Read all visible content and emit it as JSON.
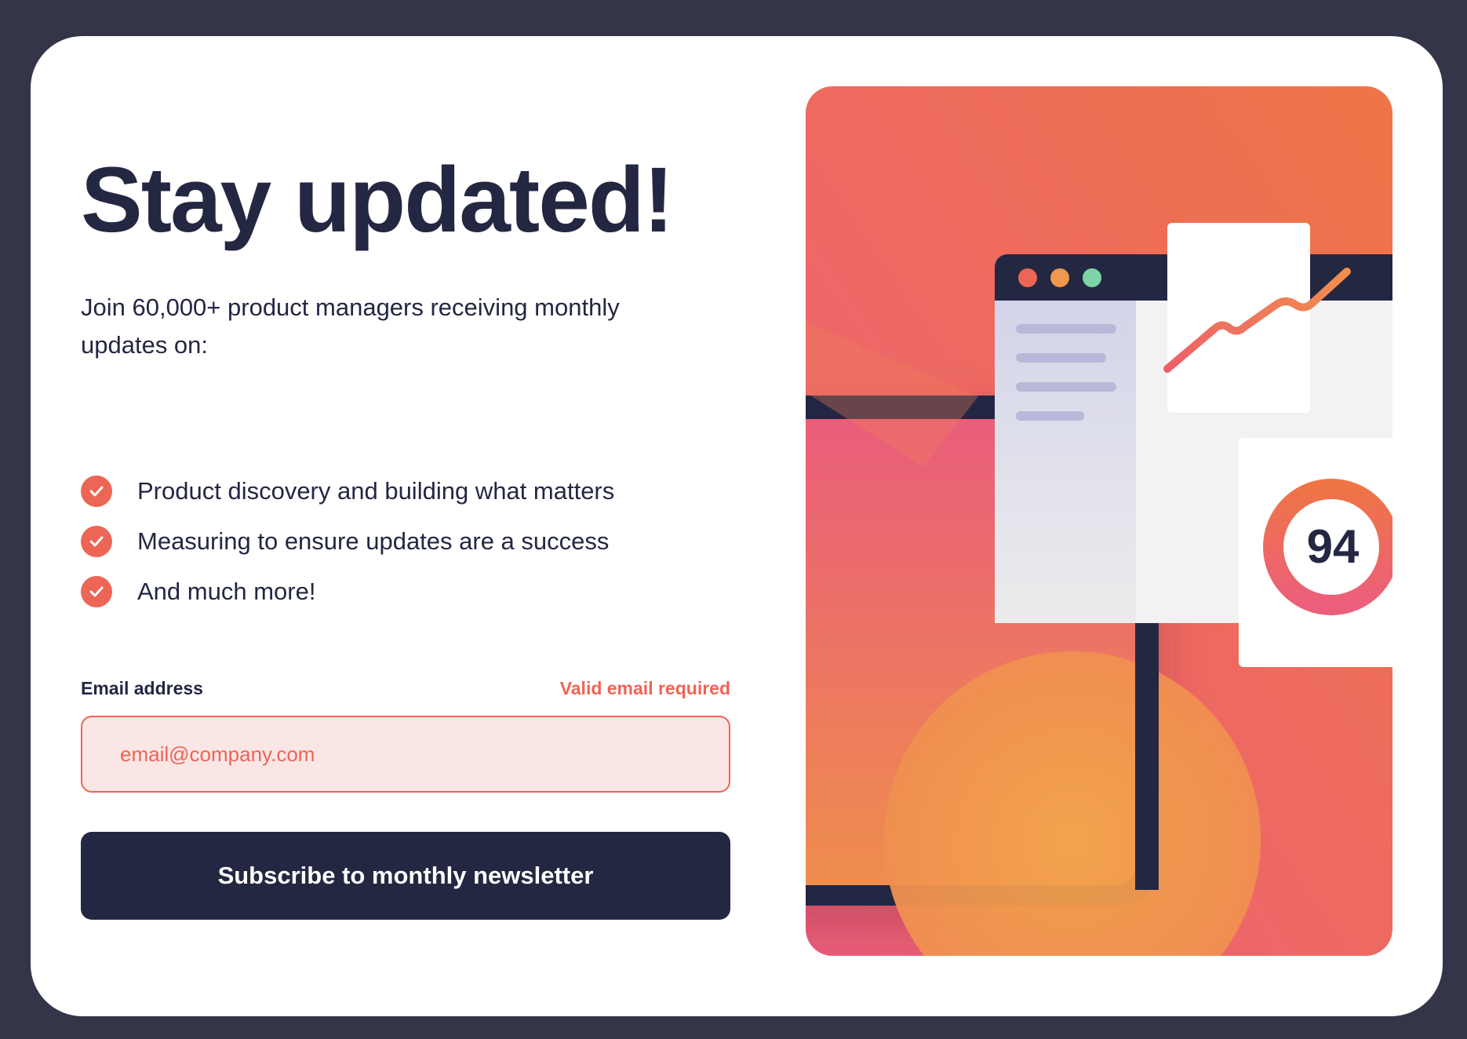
{
  "signup": {
    "title": "Stay updated!",
    "intro": "Join 60,000+ product managers receiving monthly updates on:",
    "features": [
      "Product discovery and building what matters",
      "Measuring to ensure updates are a success",
      "And much more!"
    ],
    "email_label": "Email address",
    "email_error": "Valid email required",
    "email_placeholder": "email@company.com",
    "email_value": "",
    "subscribe_label": "Subscribe to monthly newsletter"
  },
  "illustration": {
    "score": "94",
    "icons": [
      "check-icon",
      "score-ring-icon",
      "trend-line-icon"
    ]
  },
  "colors": {
    "background": "#343548",
    "card": "#ffffff",
    "text_dark": "#242742",
    "accent_tomato": "#ec6555",
    "error_bg": "#fbe6e6",
    "gradient_top": "#ef7446",
    "gradient_bottom": "#ec5f7c",
    "dot_red": "#ec6555",
    "dot_orange": "#f0984f",
    "dot_green": "#7dd4a4"
  }
}
